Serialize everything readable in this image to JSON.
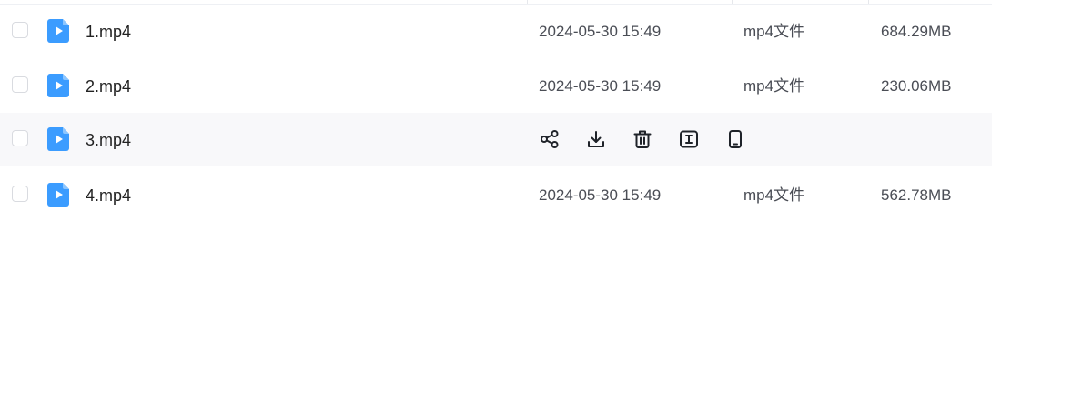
{
  "colors": {
    "accent": "#3b9cff",
    "row_hover_bg": "#f8f8fa",
    "text_primary": "#222222",
    "text_secondary": "#4a4d55"
  },
  "files": [
    {
      "name": "1.mp4",
      "modified": "2024-05-30 15:49",
      "type": "mp4文件",
      "size": "684.29MB",
      "icon": "video-file-icon"
    },
    {
      "name": "2.mp4",
      "modified": "2024-05-30 15:49",
      "type": "mp4文件",
      "size": "230.06MB",
      "icon": "video-file-icon"
    },
    {
      "name": "3.mp4",
      "hovered": true,
      "icon": "video-file-icon",
      "actions": [
        "share-icon",
        "download-icon",
        "delete-icon",
        "rename-icon",
        "phone-icon"
      ]
    },
    {
      "name": "4.mp4",
      "modified": "2024-05-30 15:49",
      "type": "mp4文件",
      "size": "562.78MB",
      "icon": "video-file-icon"
    }
  ]
}
